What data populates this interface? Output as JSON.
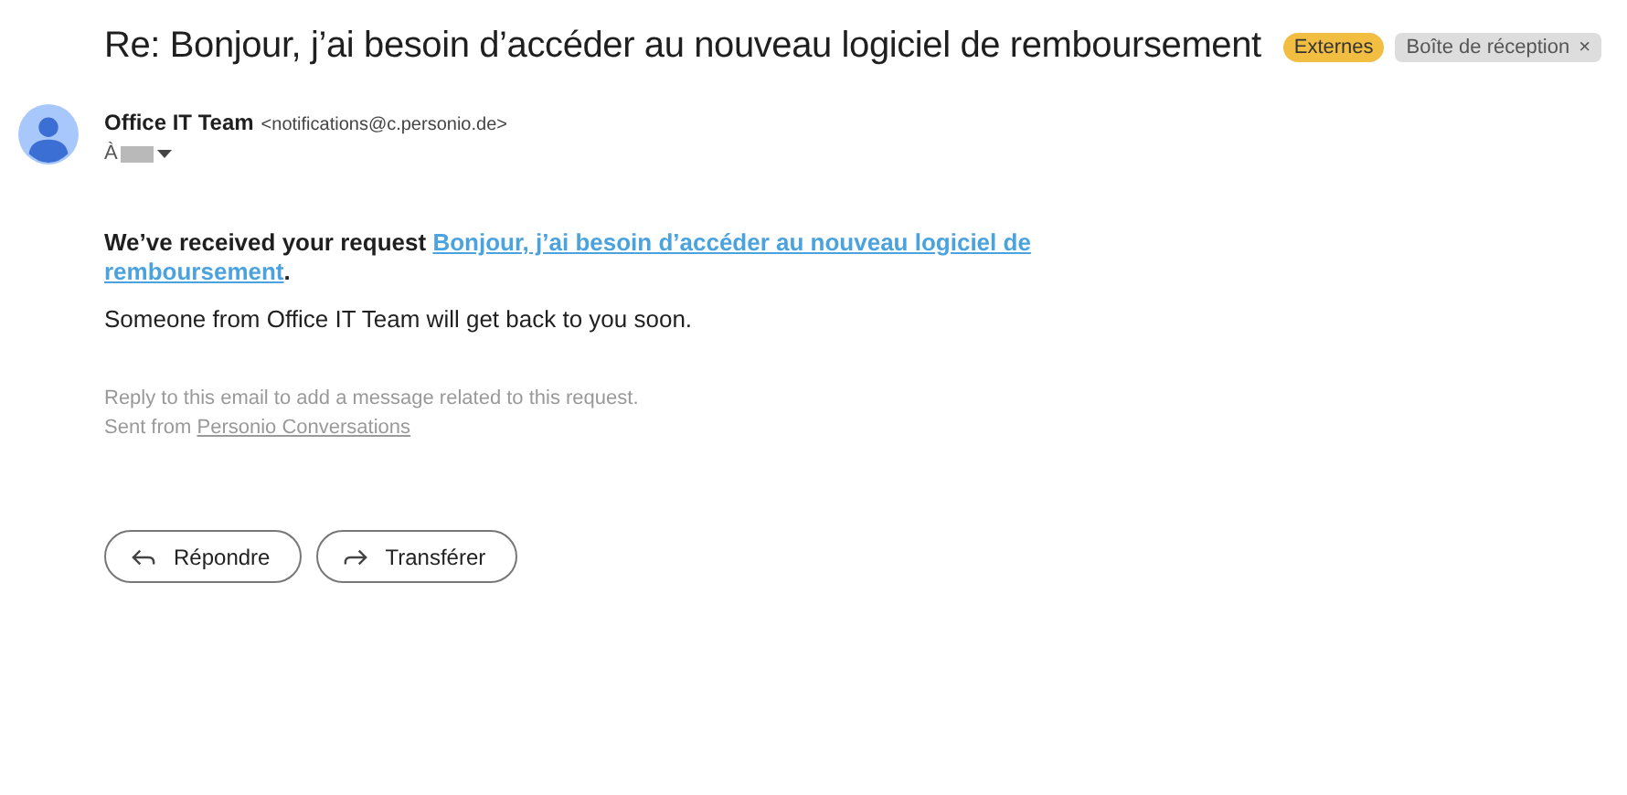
{
  "subject": "Re: Bonjour, j’ai besoin d’accéder au nouveau logiciel de remboursement",
  "labels": [
    {
      "text": "Externes",
      "color": "#f2be42",
      "removable": false
    },
    {
      "text": "Boîte de réception",
      "color": "#dddddd",
      "removable": true,
      "remove": "×"
    }
  ],
  "sender": {
    "name": "Office IT Team",
    "email": "<notifications@c.personio.de>",
    "to_prefix": "À"
  },
  "body": {
    "lead": "We’ve received your request ",
    "link_lines": [
      "Bonjour, j’ai besoin d’accéder au nouveau logiciel de",
      "remboursement"
    ],
    "end": ".",
    "line": "Someone from Office IT Team will get back to you soon."
  },
  "footer": {
    "note": "Reply to this email to add a message related to this request.",
    "sent_prefix": "Sent from ",
    "sent_link": "Personio Conversations"
  },
  "actions": [
    {
      "kind": "reply",
      "label": "Répondre"
    },
    {
      "kind": "forward",
      "label": "Transférer"
    }
  ]
}
